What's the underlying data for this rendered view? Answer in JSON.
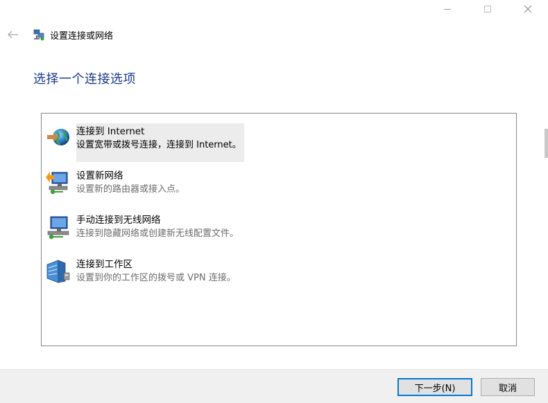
{
  "window": {
    "title": "设置连接或网络"
  },
  "heading": "选择一个连接选项",
  "options": [
    {
      "title": "连接到 Internet",
      "description": "设置宽带或拨号连接，连接到 Internet。",
      "icon": "globe-connect-icon",
      "selected": true
    },
    {
      "title": "设置新网络",
      "description": "设置新的路由器或接入点。",
      "icon": "new-network-icon",
      "selected": false
    },
    {
      "title": "手动连接到无线网络",
      "description": "连接到隐藏网络或创建新无线配置文件。",
      "icon": "wireless-network-icon",
      "selected": false
    },
    {
      "title": "连接到工作区",
      "description": "设置到你的工作区的拨号或 VPN 连接。",
      "icon": "workplace-icon",
      "selected": false
    }
  ],
  "buttons": {
    "next": "下一步(N)",
    "cancel": "取消"
  },
  "colors": {
    "heading": "#1c3a8a",
    "selection": "#ececec",
    "focus_border": "#0078d7"
  }
}
